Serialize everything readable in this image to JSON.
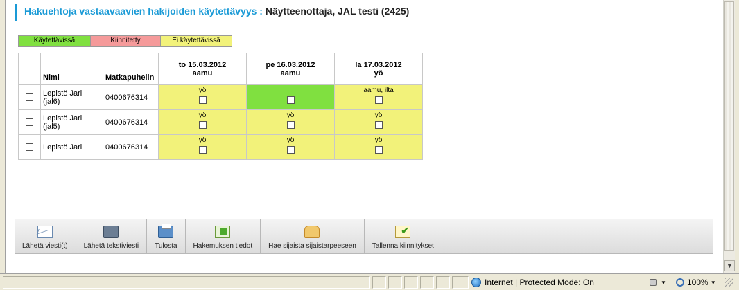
{
  "header": {
    "label": "Hakuehtoja vastaavaavien hakijoiden käytettävyys : ",
    "value": "Näytteenottaja, JAL testi (2425)"
  },
  "legend": {
    "available": "Käytettävissä",
    "pinned": "Kiinnitetty",
    "unavailable": "Ei käytettävissä",
    "colors": {
      "available": "#80e040",
      "pinned": "#f59a9a",
      "unavailable": "#f2f27a"
    }
  },
  "table": {
    "headers": {
      "name": "Nimi",
      "phone": "Matkapuhelin",
      "days": [
        {
          "date": "to 15.03.2012",
          "shift": "aamu"
        },
        {
          "date": "pe 16.03.2012",
          "shift": "aamu"
        },
        {
          "date": "la 17.03.2012",
          "shift": "yö"
        }
      ]
    },
    "rows": [
      {
        "name": "Lepistö Jari (jal6)",
        "phone": "0400676314",
        "slots": [
          "yö",
          "",
          "aamu, ilta"
        ]
      },
      {
        "name": "Lepistö Jari (jal5)",
        "phone": "0400676314",
        "slots": [
          "yö",
          "yö",
          "yö"
        ]
      },
      {
        "name": "Lepistö Jari",
        "phone": "0400676314",
        "slots": [
          "yö",
          "yö",
          "yö"
        ]
      }
    ]
  },
  "toolbar": {
    "send_message": "Lähetä viesti(t)",
    "send_sms": "Lähetä tekstiviesti",
    "print": "Tulosta",
    "application_info": "Hakemuksen tiedot",
    "find_substitute": "Hae sijaista sijaistarpeeseen",
    "save_pins": "Tallenna kiinnitykset"
  },
  "statusbar": {
    "zone": "Internet | Protected Mode: On",
    "zoom": "100%"
  }
}
